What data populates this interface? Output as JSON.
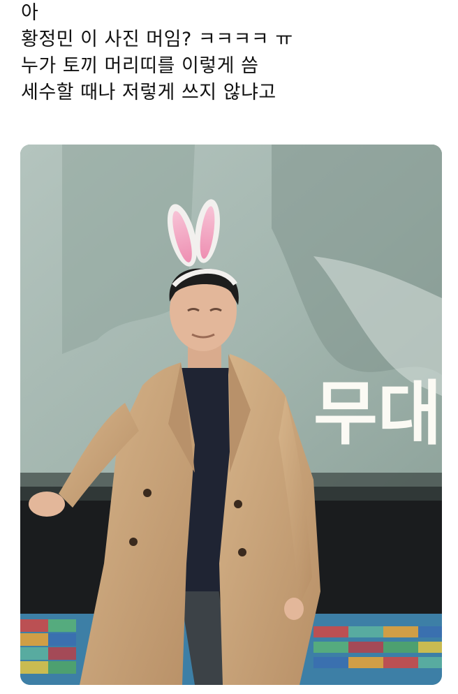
{
  "tweet": {
    "lines": [
      "아",
      "황정민 이 사진 머임? ㅋㅋㅋㅋ ㅠ",
      "누가 토끼 머리띠를 이렇게 씀",
      "세수할 때나 저렇게 쓰지 않냐고"
    ]
  },
  "media": {
    "screen_text": "무대",
    "colors": {
      "screen": "#9fb3ac",
      "coat": "#c9a57a",
      "sweater": "#1f2433",
      "ears_outer": "#f2f0ee",
      "ears_inner": "#f2a3c0",
      "floor": "#4a8fb5"
    }
  }
}
